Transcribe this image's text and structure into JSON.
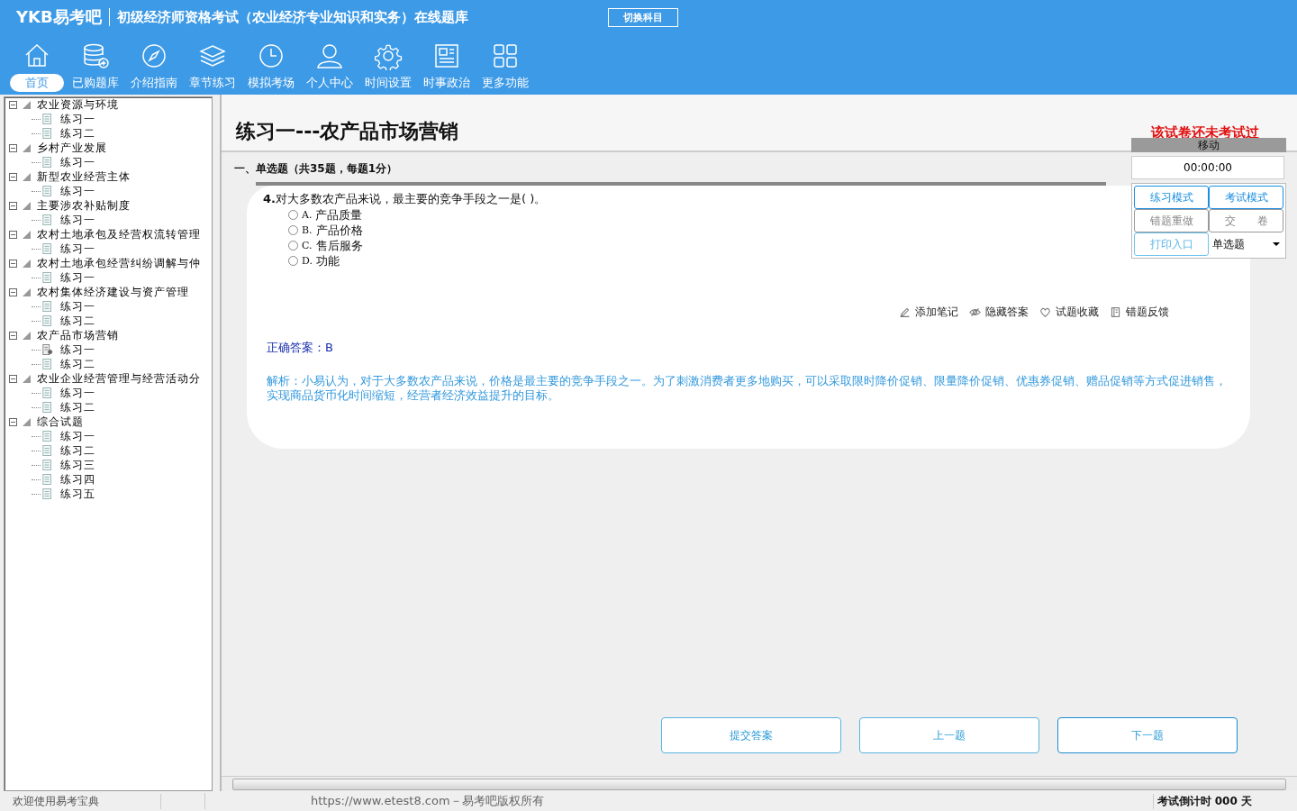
{
  "header": {
    "logo": "YKB易考吧",
    "title": "初级经济师资格考试（农业经济专业知识和实务）在线题库",
    "switch_button": "切换科目"
  },
  "nav": [
    {
      "label": "首页",
      "kind": "home",
      "selected": true
    },
    {
      "label": "已购题库",
      "kind": "database",
      "selected": false
    },
    {
      "label": "介绍指南",
      "kind": "compass",
      "selected": false
    },
    {
      "label": "章节练习",
      "kind": "layers",
      "selected": false
    },
    {
      "label": "模拟考场",
      "kind": "clock",
      "selected": false
    },
    {
      "label": "个人中心",
      "kind": "user",
      "selected": false
    },
    {
      "label": "时间设置",
      "kind": "gear",
      "selected": false
    },
    {
      "label": "时事政治",
      "kind": "news",
      "selected": false
    },
    {
      "label": "更多功能",
      "kind": "grid",
      "selected": false
    }
  ],
  "tree": [
    {
      "label": "农业资源与环境",
      "expanded": true,
      "children": [
        {
          "label": "练习一",
          "current": false
        },
        {
          "label": "练习二",
          "current": false
        }
      ]
    },
    {
      "label": "乡村产业发展",
      "expanded": true,
      "children": [
        {
          "label": "练习一",
          "current": false
        }
      ]
    },
    {
      "label": "新型农业经营主体",
      "expanded": true,
      "children": [
        {
          "label": "练习一",
          "current": false
        }
      ]
    },
    {
      "label": "主要涉农补贴制度",
      "expanded": true,
      "children": [
        {
          "label": "练习一",
          "current": false
        }
      ]
    },
    {
      "label": "农村土地承包及经营权流转管理",
      "expanded": true,
      "children": [
        {
          "label": "练习一",
          "current": false
        }
      ]
    },
    {
      "label": "农村土地承包经营纠纷调解与仲",
      "expanded": true,
      "children": [
        {
          "label": "练习一",
          "current": false
        }
      ]
    },
    {
      "label": "农村集体经济建设与资产管理",
      "expanded": true,
      "children": [
        {
          "label": "练习一",
          "current": false
        },
        {
          "label": "练习二",
          "current": false
        }
      ]
    },
    {
      "label": "农产品市场营销",
      "expanded": true,
      "children": [
        {
          "label": "练习一",
          "current": true
        },
        {
          "label": "练习二",
          "current": false
        }
      ]
    },
    {
      "label": "农业企业经营管理与经营活动分",
      "expanded": true,
      "children": [
        {
          "label": "练习一",
          "current": false
        },
        {
          "label": "练习二",
          "current": false
        }
      ]
    },
    {
      "label": "综合试题",
      "expanded": true,
      "children": [
        {
          "label": "练习一",
          "current": false
        },
        {
          "label": "练习二",
          "current": false
        },
        {
          "label": "练习三",
          "current": false
        },
        {
          "label": "练习四",
          "current": false
        },
        {
          "label": "练习五",
          "current": false
        }
      ]
    }
  ],
  "exam": {
    "title": "练习一---农产品市场营销",
    "status": "该试卷还未考试过",
    "section": "一、单选题（共35题，每题1分）",
    "question": {
      "number": "4.",
      "text": "对大多数农产品来说，最主要的竞争手段之一是( )。",
      "options": [
        {
          "label": "A.",
          "text": "产品质量",
          "selected": false
        },
        {
          "label": "B.",
          "text": "产品价格",
          "selected": false
        },
        {
          "label": "C.",
          "text": "售后服务",
          "selected": false
        },
        {
          "label": "D.",
          "text": "功能",
          "selected": false
        }
      ]
    },
    "tools": [
      {
        "label": "添加笔记",
        "kind": "pencil"
      },
      {
        "label": "隐藏答案",
        "kind": "eye"
      },
      {
        "label": "试题收藏",
        "kind": "heart"
      },
      {
        "label": "错题反馈",
        "kind": "book"
      }
    ],
    "answer_label": "正确答案：",
    "answer": "B",
    "analysis": "解析：小易认为，对于大多数农产品来说，价格是最主要的竞争手段之一。为了刺激消费者更多地购买，可以采取限时降价促销、限量降价促销、优惠券促销、赠品促销等方式促进销售，实现商品货币化时间缩短，经营者经济效益提升的目标。"
  },
  "side": {
    "drag_bar": "移动",
    "timer": "00:00:00",
    "buttons": [
      {
        "label": "练习模式",
        "disabled": false
      },
      {
        "label": "考试模式",
        "disabled": false
      },
      {
        "label": "错题重做",
        "disabled": true
      },
      {
        "label": "交　　卷",
        "disabled": true
      },
      {
        "label": "打印入口",
        "disabled": false
      }
    ],
    "type_select": "单选题"
  },
  "footer_buttons": [
    "提交答案",
    "上一题",
    "下一题"
  ],
  "status_bar": {
    "welcome": "欢迎使用易考宝典",
    "copyright": "https://www.etest8.com－易考吧版权所有",
    "countdown": "考试倒计时 000 天"
  }
}
